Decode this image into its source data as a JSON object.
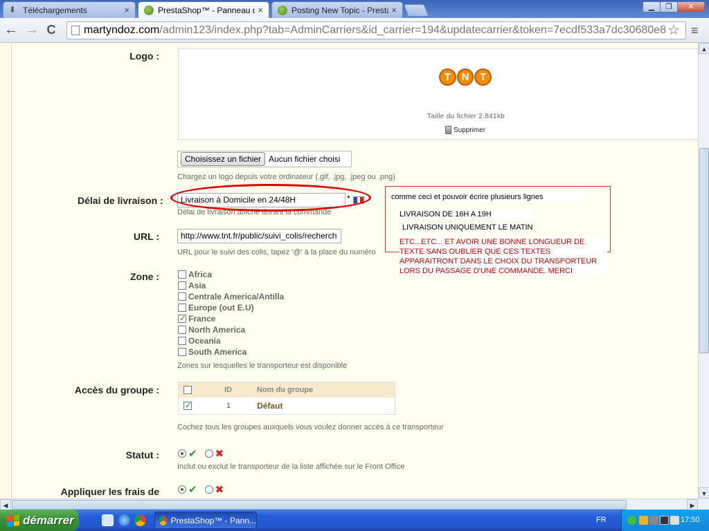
{
  "tabs": [
    {
      "title": "Téléchargements",
      "close": "×"
    },
    {
      "title": "PrestaShop™ - Panneau d'ad",
      "close": "×"
    },
    {
      "title": "Posting New Topic - PrestaSh",
      "close": "×"
    }
  ],
  "window": {
    "minimize": "▁",
    "restore": "❐",
    "close": "✕"
  },
  "toolbar": {
    "back": "←",
    "forward": "→",
    "reload": "C",
    "url_host": "martyndoz.com",
    "url_path": "/admin123/index.php?tab=AdminCarriers&id_carrier=194&updatecarrier&token=7ecdf533a7dc30680e8"
  },
  "form": {
    "logo_label": "Logo :",
    "file_size": "Taille du fichier 2.841kb",
    "delete_label": "Supprimer",
    "file_button": "Choisissez un fichier",
    "file_status": "Aucun fichier choisi",
    "logo_hint": "Chargez un logo depuis votre ordinateur (.gif, .jpg, .jpeg ou .png)",
    "delay_label": "Délai de livraison :",
    "delay_value": "Livraison à Domicile en 24/48H",
    "required_mark": "*",
    "delay_hint": "Délai de livraison affiché durant la commande",
    "url_label": "URL :",
    "url_value": "http://www.tnt.fr/public/suivi_colis/recherch",
    "url_hint": "URL pour le suivi des colis, tapez '@' à la place du numéro",
    "zone_label": "Zone :",
    "zones": [
      {
        "name": "Africa",
        "checked": false
      },
      {
        "name": "Asia",
        "checked": false
      },
      {
        "name": "Centrale America/Antilla",
        "checked": false
      },
      {
        "name": "Europe (out E.U)",
        "checked": false
      },
      {
        "name": "France",
        "checked": true
      },
      {
        "name": "North America",
        "checked": false
      },
      {
        "name": "Oceania",
        "checked": false
      },
      {
        "name": "South America",
        "checked": false
      }
    ],
    "zone_hint": "Zones sur lesquelles le transporteur est disponible",
    "group_label": "Accès du groupe :",
    "group_col_id": "ID",
    "group_col_name": "Nom du groupe",
    "group_row_id": "1",
    "group_row_name": "Défaut",
    "group_hint": "Cochez tous les groupes auxquels vous voulez donner accès à ce transporteur",
    "status_label": "Statut :",
    "status_hint": "Inclut ou exclut le transporteur de la liste affichée sur le Front Office",
    "fees_label": "Appliquer les frais de"
  },
  "annotation": {
    "line1": "comme ceci et pouvoir écrire plusieurs lignes",
    "line2": "LIVRAISON DE 16H A 19H",
    "line3": "LIVRAISON UNIQUEMENT LE MATIN",
    "red_text": "ETC...ETC...    ET AVOIR UNE BONNE LONGUEUR DE TEXTE SANS OUBLIER QUE CES TEXTES APPARAITRONT DANS LE CHOIX DU TRANSPORTEUR LORS DU PASSAGE D'UNE COMMANDE.   MERCI"
  },
  "tnt_letters": [
    "T",
    "N",
    "T"
  ],
  "taskbar": {
    "start": "démarrer",
    "task_title": "PrestaShop™ - Pann...",
    "lang": "FR",
    "clock": "17:50"
  },
  "colors": {
    "accent_red": "#e00000",
    "tnt_orange": "#f28c00",
    "xp_blue": "#245edb",
    "xp_green": "#3c943c"
  }
}
